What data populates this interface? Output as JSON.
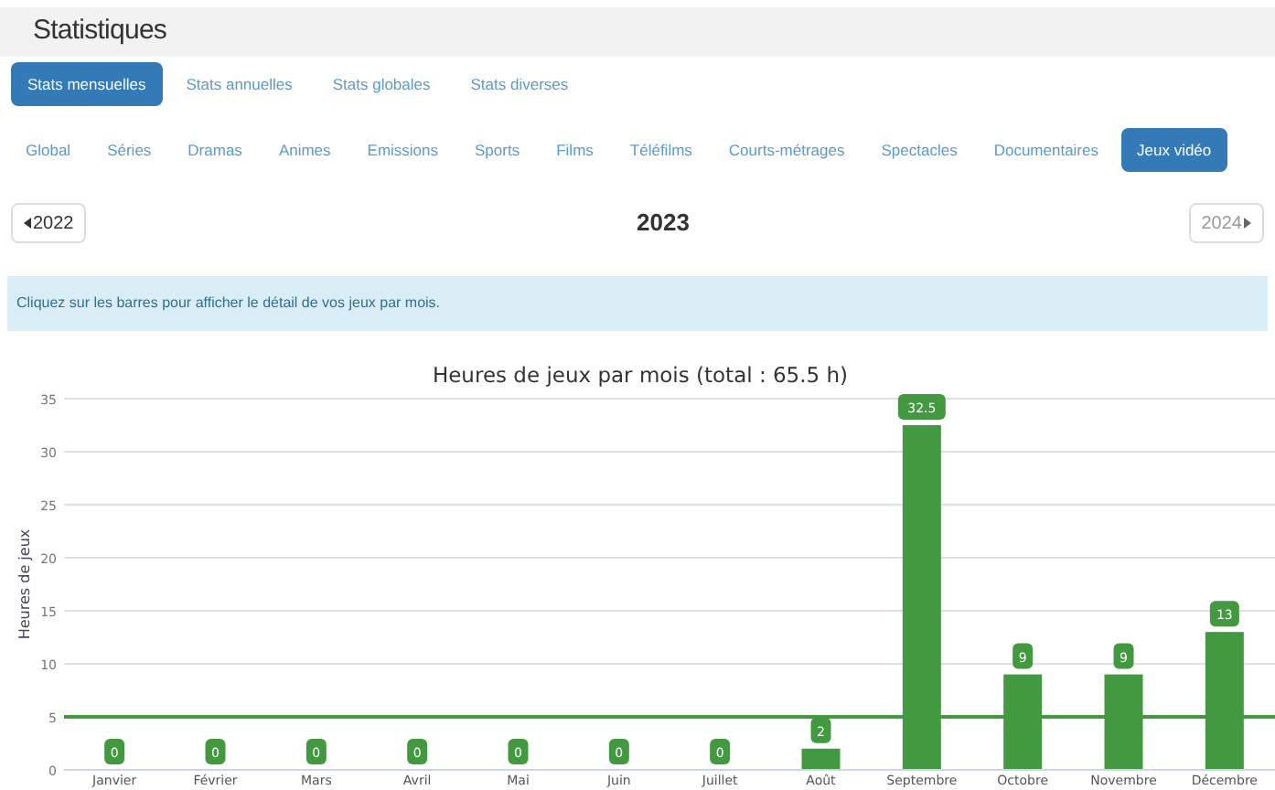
{
  "header": {
    "title": "Statistiques"
  },
  "main_tabs": [
    {
      "label": "Stats mensuelles",
      "selected": true
    },
    {
      "label": "Stats annuelles",
      "selected": false
    },
    {
      "label": "Stats globales",
      "selected": false
    },
    {
      "label": "Stats diverses",
      "selected": false
    }
  ],
  "category_tabs": [
    {
      "label": "Global",
      "selected": false
    },
    {
      "label": "Séries",
      "selected": false
    },
    {
      "label": "Dramas",
      "selected": false
    },
    {
      "label": "Animes",
      "selected": false
    },
    {
      "label": "Emissions",
      "selected": false
    },
    {
      "label": "Sports",
      "selected": false
    },
    {
      "label": "Films",
      "selected": false
    },
    {
      "label": "Téléfilms",
      "selected": false
    },
    {
      "label": "Courts-métrages",
      "selected": false
    },
    {
      "label": "Spectacles",
      "selected": false
    },
    {
      "label": "Documentaires",
      "selected": false
    },
    {
      "label": "Jeux vidéo",
      "selected": true
    }
  ],
  "year_nav": {
    "previous": "2022",
    "current": "2023",
    "next": "2024"
  },
  "info": "Cliquez sur les barres pour afficher le détail de vos jeux par mois.",
  "chart": {
    "chart_data": {
      "type": "bar",
      "title": "Heures de jeux par mois (total : 65.5 h)",
      "ylabel": "Heures de jeux",
      "categories": [
        "Janvier",
        "Février",
        "Mars",
        "Avril",
        "Mai",
        "Juin",
        "Juillet",
        "Août",
        "Septembre",
        "Octobre",
        "Novembre",
        "Décembre"
      ],
      "series": [
        {
          "color": "#43993f",
          "values": [
            0,
            0,
            0,
            0,
            0,
            0,
            0,
            2,
            32.5,
            9,
            9,
            13
          ]
        }
      ],
      "ylim": [
        0,
        35
      ],
      "yticks": [
        0,
        5,
        10,
        15,
        20,
        25,
        30,
        35
      ],
      "data_labels": true,
      "grid": true,
      "ref_lines": [
        {
          "axis": "y",
          "value": 5,
          "color": "#43993f"
        }
      ]
    }
  }
}
